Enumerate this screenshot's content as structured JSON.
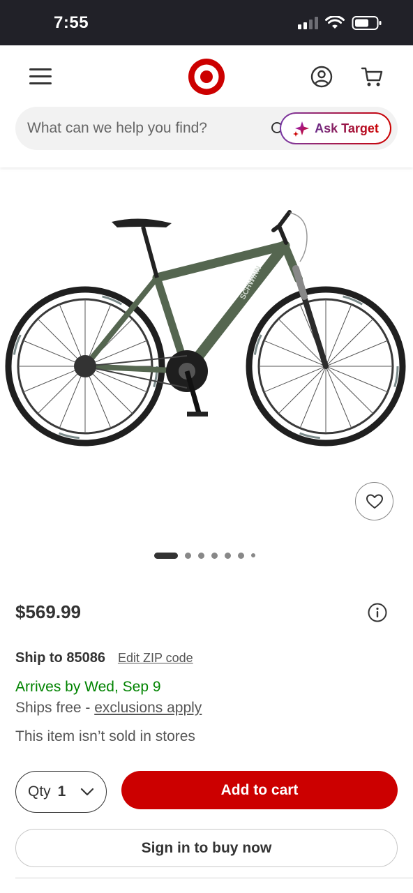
{
  "status_bar": {
    "time": "7:55",
    "signal_bars_active": 2,
    "signal_bars_total": 4,
    "icons": [
      "cellular-signal-icon",
      "wifi-icon",
      "battery-icon"
    ]
  },
  "header": {
    "icons": [
      "menu-icon",
      "target-logo",
      "account-icon",
      "cart-icon"
    ],
    "brand_color": "#cc0000"
  },
  "search": {
    "placeholder": "What can we help you find?",
    "ask_label": "Ask Target"
  },
  "product": {
    "image_alt_icon": "bicycle-image",
    "carousel": {
      "total_dots": 7,
      "active_index": 0
    },
    "price": "$569.99",
    "ship_to": "Ship to 85086",
    "edit_zip": "Edit ZIP code",
    "arrives": "Arrives by Wed, Sep 9",
    "ships_free_prefix": "Ships free - ",
    "ships_free_link": "exclusions apply",
    "store_note": "This item isn’t sold in stores",
    "arrival_color": "#008300"
  },
  "actions": {
    "qty_label": "Qty",
    "qty_value": "1",
    "add_to_cart": "Add to cart",
    "sign_in_buy": "Sign in to buy now"
  }
}
